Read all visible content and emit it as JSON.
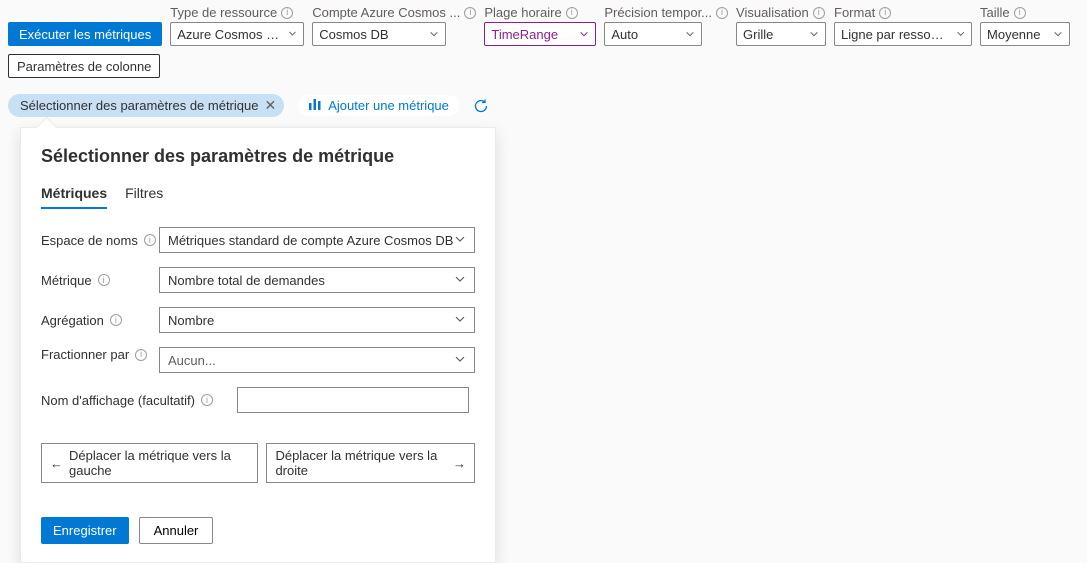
{
  "toolbar": {
    "run_button": "Exécuter les métriques",
    "col_params_button": "Paramètres de colonne",
    "params": {
      "resource_type": {
        "label": "Type de ressource",
        "value": "Azure Cosmos DB..."
      },
      "account": {
        "label": "Compte Azure Cosmos ...",
        "value": "Cosmos DB"
      },
      "time_range": {
        "label": "Plage horaire",
        "value": "TimeRange"
      },
      "granularity": {
        "label": "Précision tempor...",
        "value": "Auto"
      },
      "visualization": {
        "label": "Visualisation",
        "value": "Grille"
      },
      "format": {
        "label": "Format",
        "value": "Ligne par ressource"
      },
      "size": {
        "label": "Taille",
        "value": "Moyenne"
      }
    }
  },
  "pills": {
    "active": "Sélectionner des paramètres de métrique",
    "add": "Ajouter une métrique"
  },
  "panel": {
    "title": "Sélectionner des paramètres de métrique",
    "tabs": {
      "metrics": "Métriques",
      "filters": "Filtres"
    },
    "fields": {
      "namespace": {
        "label": "Espace de noms",
        "value": "Métriques standard de compte Azure Cosmos DB"
      },
      "metric": {
        "label": "Métrique",
        "value": "Nombre total de demandes"
      },
      "aggregation": {
        "label": "Agrégation",
        "value": "Nombre"
      },
      "split": {
        "label": "Fractionner par",
        "value": "Aucun..."
      },
      "display_name": {
        "label": "Nom d'affichage (facultatif)",
        "value": ""
      }
    },
    "move_left": "Déplacer la métrique vers la gauche",
    "move_right": "Déplacer la métrique vers la droite",
    "save": "Enregistrer",
    "cancel": "Annuler"
  }
}
